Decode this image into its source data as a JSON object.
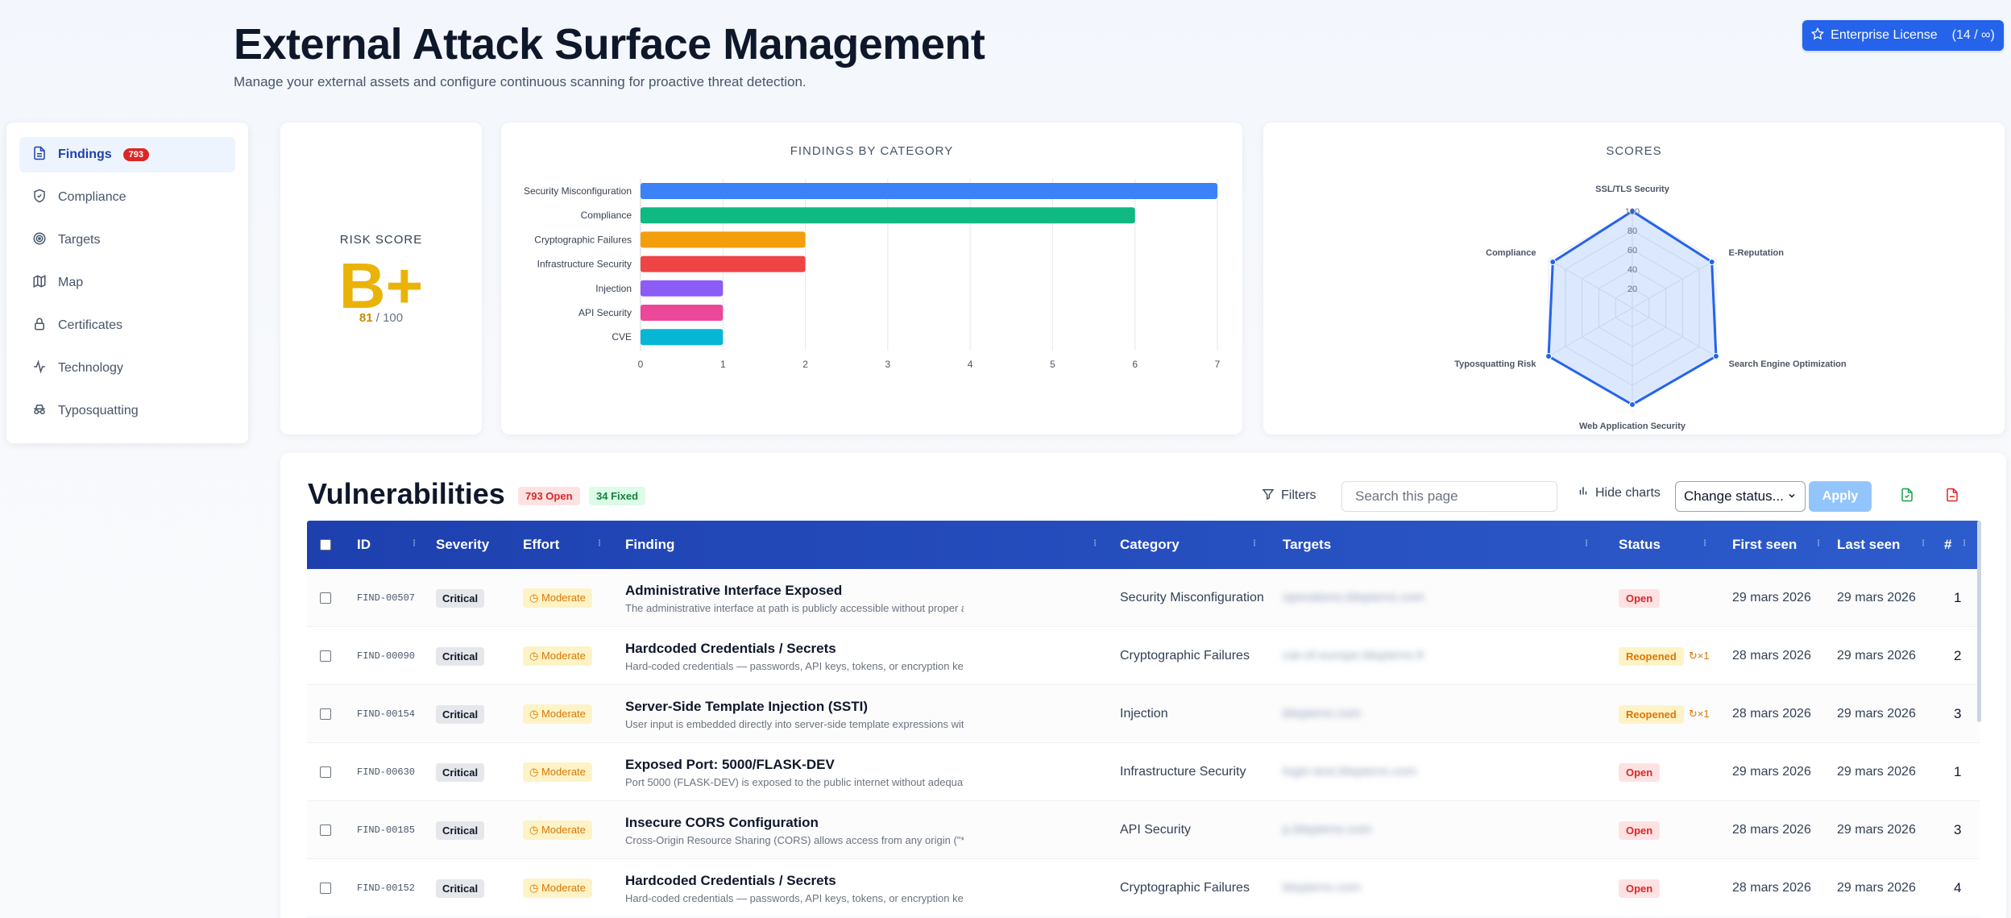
{
  "header": {
    "title": "External Attack Surface Management",
    "subtitle": "Manage your external assets and configure continuous scanning for proactive threat detection.",
    "license_label": "Enterprise License",
    "license_count": "(14 / ∞)"
  },
  "sidebar": {
    "items": [
      {
        "label": "Findings",
        "icon": "document-icon",
        "badge": "793",
        "active": true
      },
      {
        "label": "Compliance",
        "icon": "shield-check-icon"
      },
      {
        "label": "Targets",
        "icon": "target-icon"
      },
      {
        "label": "Map",
        "icon": "map-icon"
      },
      {
        "label": "Certificates",
        "icon": "lock-icon"
      },
      {
        "label": "Technology",
        "icon": "activity-icon"
      },
      {
        "label": "Typosquatting",
        "icon": "incognito-icon"
      }
    ]
  },
  "risk": {
    "label": "RISK SCORE",
    "grade": "B+",
    "score": "81",
    "max": "/ 100",
    "color": "#eab308"
  },
  "chart_data": [
    {
      "type": "bar",
      "orientation": "horizontal",
      "title": "FINDINGS BY CATEGORY",
      "categories": [
        "Security Misconfiguration",
        "Compliance",
        "Cryptographic Failures",
        "Infrastructure Security",
        "Injection",
        "API Security",
        "CVE"
      ],
      "values": [
        7,
        6,
        2,
        2,
        1,
        1,
        1
      ],
      "colors": [
        "#3b82f6",
        "#10b981",
        "#f59e0b",
        "#ef4444",
        "#8b5cf6",
        "#ec4899",
        "#06b6d4"
      ],
      "xlim": [
        0,
        7
      ],
      "xticks": [
        "0",
        "1",
        "2",
        "3",
        "4",
        "5",
        "6",
        "7"
      ],
      "grid": true
    },
    {
      "type": "radar",
      "title": "SCORES",
      "axes": [
        "SSL/TLS Security",
        "E-Reputation",
        "Search Engine Optimization",
        "Web Application Security",
        "Typosquatting Risk",
        "Compliance"
      ],
      "values": [
        100,
        95,
        100,
        100,
        100,
        95
      ],
      "rlim": [
        0,
        100
      ],
      "rticks": [
        "20",
        "40",
        "60",
        "80",
        "100"
      ],
      "color": "#2563eb"
    }
  ],
  "vulns": {
    "title": "Vulnerabilities",
    "open_badge": "793 Open",
    "fixed_badge": "34 Fixed",
    "filters_label": "Filters",
    "search_placeholder": "Search this page",
    "hide_charts_label": "Hide charts",
    "status_select": "Change status...",
    "apply_label": "Apply",
    "columns": {
      "id": "ID",
      "severity": "Severity",
      "effort": "Effort",
      "finding": "Finding",
      "category": "Category",
      "targets": "Targets",
      "status": "Status",
      "first_seen": "First seen",
      "last_seen": "Last seen",
      "count": "#"
    },
    "rows": [
      {
        "id": "FIND-00507",
        "severity": "Critical",
        "effort": "Moderate",
        "title": "Administrative Interface Exposed",
        "desc": "The administrative interface at path is publicly accessible without proper a",
        "category": "Security Misconfiguration",
        "target": "operations.blepierre.com",
        "status": "Open",
        "reopen": "",
        "first": "29 mars 2026",
        "last": "29 mars 2026",
        "count": "1"
      },
      {
        "id": "FIND-00090",
        "severity": "Critical",
        "effort": "Moderate",
        "title": "Hardcoded Credentials / Secrets",
        "desc": "Hard-coded credentials — passwords, API keys, tokens, or encryption key",
        "category": "Cryptographic Failures",
        "target": "cat-of-europe.blepierre.fr",
        "status": "Reopened",
        "reopen": "×1",
        "first": "28 mars 2026",
        "last": "29 mars 2026",
        "count": "2"
      },
      {
        "id": "FIND-00154",
        "severity": "Critical",
        "effort": "Moderate",
        "title": "Server-Side Template Injection (SSTI)",
        "desc": "User input is embedded directly into server-side template expressions witl",
        "category": "Injection",
        "target": "blepierre.com",
        "status": "Reopened",
        "reopen": "×1",
        "first": "28 mars 2026",
        "last": "29 mars 2026",
        "count": "3"
      },
      {
        "id": "FIND-00630",
        "severity": "Critical",
        "effort": "Moderate",
        "title": "Exposed Port: 5000/FLASK-DEV",
        "desc": "Port 5000 (FLASK-DEV) is exposed to the public internet without adequate",
        "category": "Infrastructure Security",
        "target": "login-test.blepierre.com",
        "status": "Open",
        "reopen": "",
        "first": "29 mars 2026",
        "last": "29 mars 2026",
        "count": "1"
      },
      {
        "id": "FIND-00185",
        "severity": "Critical",
        "effort": "Moderate",
        "title": "Insecure CORS Configuration",
        "desc": "Cross-Origin Resource Sharing (CORS) allows access from any origin (\"*\")",
        "category": "API Security",
        "target": "p.blepierre.com",
        "status": "Open",
        "reopen": "",
        "first": "28 mars 2026",
        "last": "29 mars 2026",
        "count": "3"
      },
      {
        "id": "FIND-00152",
        "severity": "Critical",
        "effort": "Moderate",
        "title": "Hardcoded Credentials / Secrets",
        "desc": "Hard-coded credentials — passwords, API keys, tokens, or encryption key",
        "category": "Cryptographic Failures",
        "target": "blepierre.com",
        "status": "Open",
        "reopen": "",
        "first": "28 mars 2026",
        "last": "29 mars 2026",
        "count": "4"
      }
    ]
  }
}
